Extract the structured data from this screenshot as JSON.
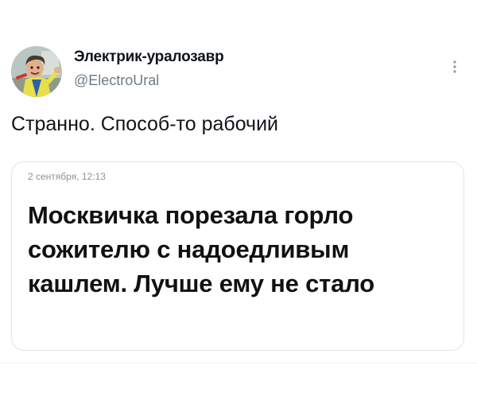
{
  "author": {
    "name": "Электрик-уралозавр",
    "handle": "@ElectroUral",
    "avatar_icon": "user-avatar"
  },
  "tweet": {
    "text": "Странно. Способ-то рабочий"
  },
  "card": {
    "date": "2 сентября, 12:13",
    "headline": "Москвичка порезала горло сожителю с надоедливым кашлем. Лучше ему не стало"
  },
  "more_icon": "vertical-ellipsis-icon",
  "colors": {
    "text": "#0f1419",
    "secondary": "#6e7b85",
    "border": "#dfe5e9"
  }
}
